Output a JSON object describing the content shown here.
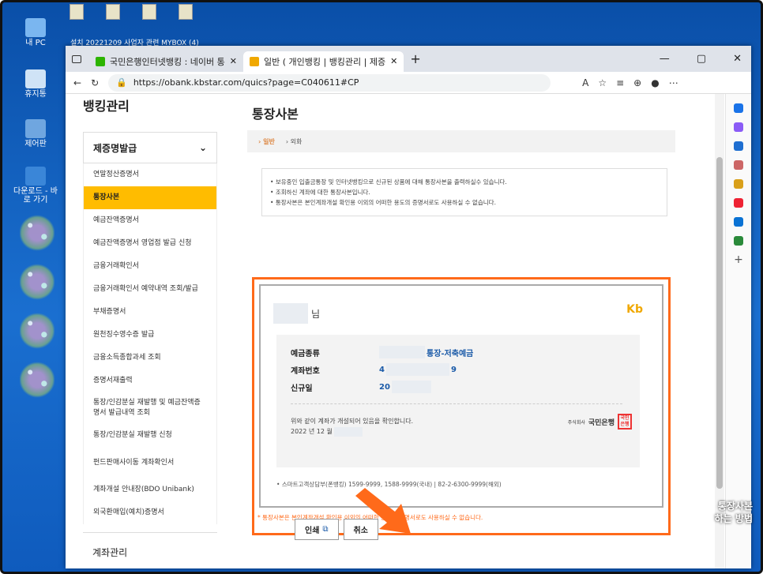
{
  "desktop": {
    "icons": [
      {
        "label": "내 PC"
      },
      {
        "label": "휴지통"
      },
      {
        "label": "제어판"
      },
      {
        "label": "다운로드 - 바로 가기"
      }
    ],
    "top_labels": "설치     20221209     사업자 관련     MYBOX (4)"
  },
  "browser": {
    "tabs": [
      {
        "label": "국민은행인터넷뱅킹 : 네이버 통",
        "active": false
      },
      {
        "label": "일반 ( 개인뱅킹 | 뱅킹관리 | 제증",
        "active": true
      }
    ],
    "new_tab": "+",
    "url": "https://obank.kbstar.com/quics?page=C040611#CP",
    "window_controls": [
      "—",
      "▢",
      "✕"
    ]
  },
  "sidebar": {
    "title": "뱅킹관리",
    "section": "제증명발급",
    "items": [
      {
        "label": "연말정산증명서"
      },
      {
        "label": "통장사본",
        "active": true
      },
      {
        "label": "예금잔액증명서"
      },
      {
        "label": "예금잔액증명서 영업점 발급 신청"
      },
      {
        "label": "금융거래확인서"
      },
      {
        "label": "금융거래확인서 예약내역 조회/발급"
      },
      {
        "label": "부채증명서"
      },
      {
        "label": "원천징수영수증 발급"
      },
      {
        "label": "금융소득종합과세 조회"
      },
      {
        "label": "증명서재출력"
      },
      {
        "label": "통장/인감분실 재발행 및 예금잔액증명서 발급내역 조회"
      },
      {
        "label": "통장/인감분실 재발행 신청"
      },
      {
        "label": "펀드판매사이동 계좌확인서"
      },
      {
        "label": "계좌개설 안내장(BDO Unibank)"
      },
      {
        "label": "외국환매입(예치)증명서"
      }
    ],
    "footer": "계좌관리"
  },
  "main": {
    "title": "통장사본",
    "subtabs": [
      "일반",
      "외화"
    ],
    "notices": [
      "보유중인 입출금통장 및 인터넷뱅킹으로 신규된 상품에 대해 통장사본을 출력하실수 있습니다.",
      "조회하신 계좌에 대한 통장사본입니다.",
      "통장사본은 본인계좌개설 확인용 이외의 어떠한 용도의 증명서로도 사용하실 수 없습니다."
    ],
    "cert": {
      "name_suffix": "님",
      "logo": "Kb",
      "fields": [
        {
          "key": "예금종류",
          "value": "통장-저축예금"
        },
        {
          "key": "계좌번호",
          "value_start": "4",
          "value_end": "9"
        },
        {
          "key": "신규일",
          "value": "20"
        }
      ],
      "confirm_text": "위와 같이 계좌가 개설되어 있음을 확인합니다.",
      "date_text": "2022 년 12 월",
      "bank_prefix": "주식회사",
      "bank_name": "국민은행",
      "seal": "국민은행",
      "contact": "스마트고객상담부(폰뱅킹) 1599-9999, 1588-9999(국내) | 82-2-6300-9999(해외)",
      "warning": "* 통장사본은 본인계좌개설 확인용 이외의 어떠한 용도의 증명서로도 사용하실 수 없습니다."
    },
    "buttons": {
      "print": "인쇄",
      "cancel": "취소"
    }
  },
  "overlay_text": [
    "통장사본",
    "하는 방법"
  ]
}
